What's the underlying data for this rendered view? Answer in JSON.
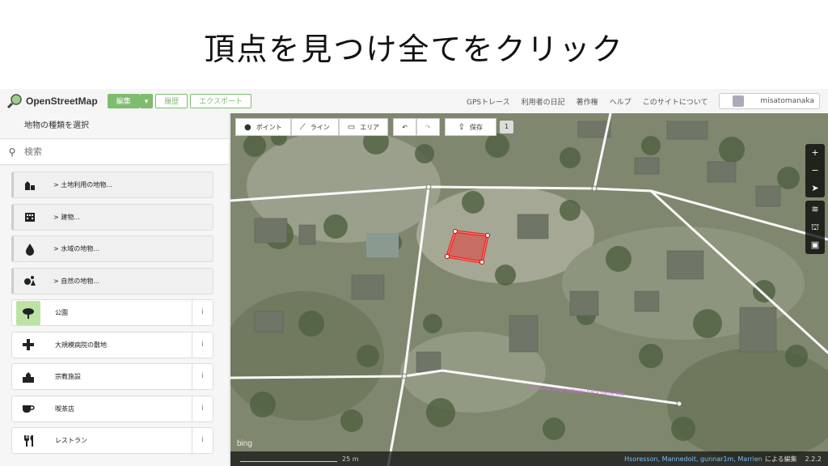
{
  "slide_title": "頂点を見つけ全てをクリック",
  "app": {
    "logo_text": "OpenStreetMap",
    "tabs": {
      "edit": "編集",
      "history": "履歴",
      "export": "エクスポート"
    },
    "nav": {
      "gps": "GPSトレース",
      "diary": "利用者の日記",
      "copyright": "著作権",
      "help": "ヘルプ",
      "about": "このサイトについて"
    },
    "username": "misatomanaka"
  },
  "sidebar": {
    "header": "地物の種類を選択",
    "search_placeholder": "検索",
    "presets": [
      {
        "label": "> 土地利用の地物...",
        "icon": "landuse-icon",
        "category": true
      },
      {
        "label": "> 建物...",
        "icon": "building-icon",
        "category": true
      },
      {
        "label": "> 水域の地物...",
        "icon": "water-icon",
        "category": true
      },
      {
        "label": "> 自然の地物...",
        "icon": "natural-icon",
        "category": true
      },
      {
        "label": "公園",
        "icon": "park-tree-icon",
        "category": false
      },
      {
        "label": "大規模病院の敷地",
        "icon": "hospital-cross-icon",
        "category": false
      },
      {
        "label": "宗教施設",
        "icon": "religious-icon",
        "category": false
      },
      {
        "label": "喫茶店",
        "icon": "cafe-cup-icon",
        "category": false
      },
      {
        "label": "レストラン",
        "icon": "restaurant-icon",
        "category": false
      }
    ],
    "info_glyph": "i"
  },
  "toolbar": {
    "point": "ポイント",
    "line": "ライン",
    "area": "エリア",
    "save": "保存",
    "save_count": "1"
  },
  "map": {
    "scale_label": "25 m",
    "bing_label": "bing",
    "attribution": "Hsoresson, Mannedoit, gunnar1m, Marrien",
    "attribution_suffix": "による編集",
    "version": "2.2.2",
    "road_name": "Tanzania area highway track name bbb"
  }
}
